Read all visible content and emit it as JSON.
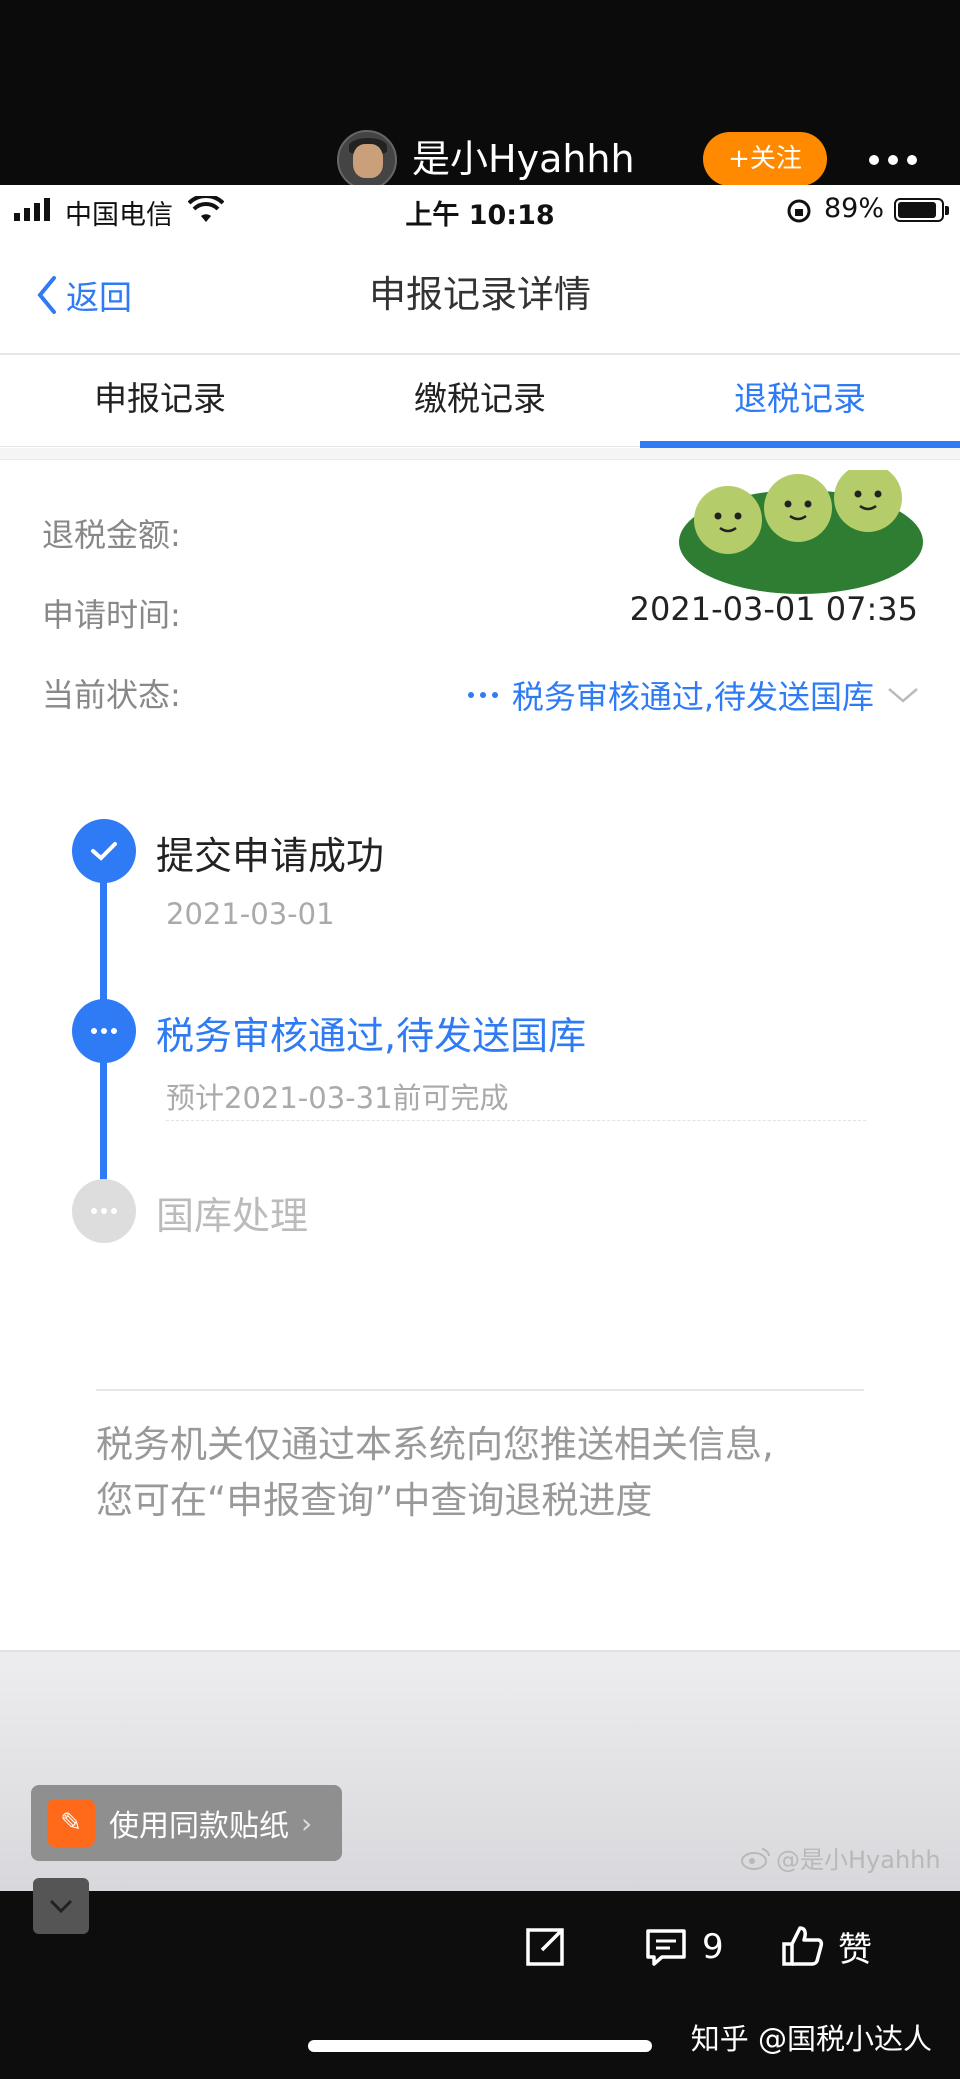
{
  "weibo_header": {
    "username": "是小Hyahhh",
    "follow_label": "+关注"
  },
  "status_bar": {
    "carrier": "中国电信",
    "time": "上午 10:18",
    "battery_percent": "89%"
  },
  "nav": {
    "back_label": "返回",
    "title": "申报记录详情"
  },
  "tabs": [
    {
      "label": "申报记录",
      "active": false
    },
    {
      "label": "缴税记录",
      "active": false
    },
    {
      "label": "退税记录",
      "active": true
    }
  ],
  "details": {
    "amount_label": "退税金额:",
    "time_label": "申请时间:",
    "time_value": "2021-03-01 07:35",
    "status_label": "当前状态:",
    "status_value": "税务审核通过,待发送国库"
  },
  "timeline": [
    {
      "title": "提交申请成功",
      "subtitle": "2021-03-01",
      "state": "done"
    },
    {
      "title": "税务审核通过,待发送国库",
      "subtitle": "预计2021-03-31前可完成",
      "state": "current"
    },
    {
      "title": "国库处理",
      "subtitle": "",
      "state": "pending"
    }
  ],
  "notice": {
    "line1": "税务机关仅通过本系统向您推送相关信息,",
    "line2": "您可在“申报查询”中查询退税进度"
  },
  "sticker_button": {
    "label": "使用同款贴纸"
  },
  "watermark": "@是小Hyahhh",
  "weibo_footer": {
    "comment_count": "9",
    "like_label": "赞",
    "zhihu_credit": "知乎 @国税小达人"
  },
  "colors": {
    "accent": "#2f7bf5",
    "follow_orange": "#ff8a00",
    "muted": "#aaaaaa"
  }
}
